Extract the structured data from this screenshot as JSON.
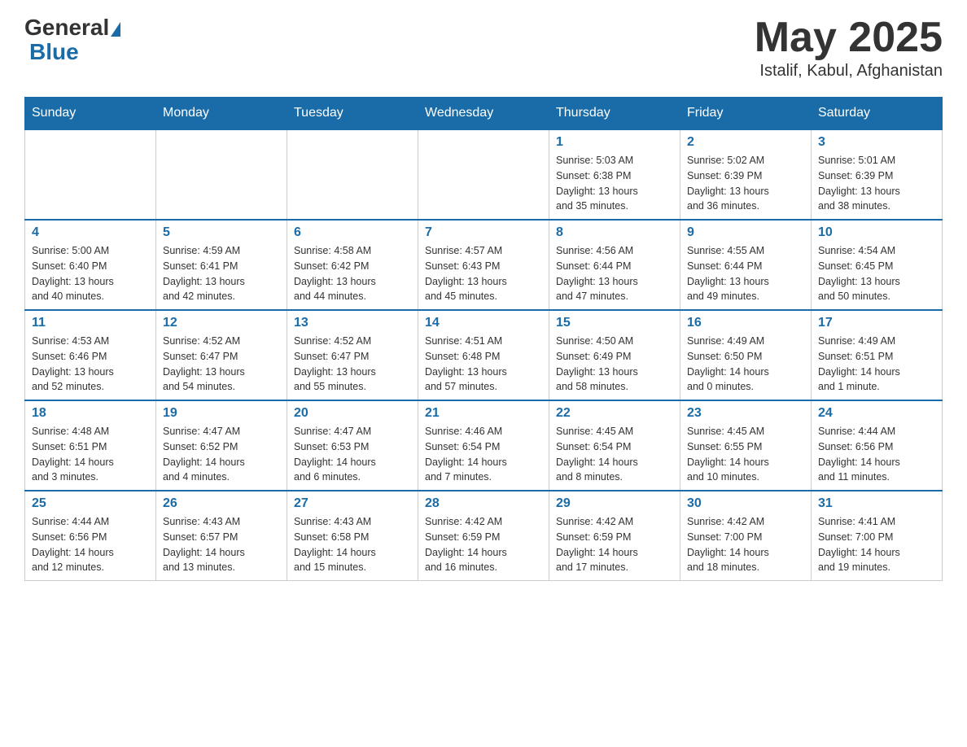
{
  "header": {
    "logo_general": "General",
    "logo_blue": "Blue",
    "month_year": "May 2025",
    "location": "Istalif, Kabul, Afghanistan"
  },
  "days_of_week": [
    "Sunday",
    "Monday",
    "Tuesday",
    "Wednesday",
    "Thursday",
    "Friday",
    "Saturday"
  ],
  "weeks": [
    [
      {
        "day": "",
        "info": ""
      },
      {
        "day": "",
        "info": ""
      },
      {
        "day": "",
        "info": ""
      },
      {
        "day": "",
        "info": ""
      },
      {
        "day": "1",
        "info": "Sunrise: 5:03 AM\nSunset: 6:38 PM\nDaylight: 13 hours\nand 35 minutes."
      },
      {
        "day": "2",
        "info": "Sunrise: 5:02 AM\nSunset: 6:39 PM\nDaylight: 13 hours\nand 36 minutes."
      },
      {
        "day": "3",
        "info": "Sunrise: 5:01 AM\nSunset: 6:39 PM\nDaylight: 13 hours\nand 38 minutes."
      }
    ],
    [
      {
        "day": "4",
        "info": "Sunrise: 5:00 AM\nSunset: 6:40 PM\nDaylight: 13 hours\nand 40 minutes."
      },
      {
        "day": "5",
        "info": "Sunrise: 4:59 AM\nSunset: 6:41 PM\nDaylight: 13 hours\nand 42 minutes."
      },
      {
        "day": "6",
        "info": "Sunrise: 4:58 AM\nSunset: 6:42 PM\nDaylight: 13 hours\nand 44 minutes."
      },
      {
        "day": "7",
        "info": "Sunrise: 4:57 AM\nSunset: 6:43 PM\nDaylight: 13 hours\nand 45 minutes."
      },
      {
        "day": "8",
        "info": "Sunrise: 4:56 AM\nSunset: 6:44 PM\nDaylight: 13 hours\nand 47 minutes."
      },
      {
        "day": "9",
        "info": "Sunrise: 4:55 AM\nSunset: 6:44 PM\nDaylight: 13 hours\nand 49 minutes."
      },
      {
        "day": "10",
        "info": "Sunrise: 4:54 AM\nSunset: 6:45 PM\nDaylight: 13 hours\nand 50 minutes."
      }
    ],
    [
      {
        "day": "11",
        "info": "Sunrise: 4:53 AM\nSunset: 6:46 PM\nDaylight: 13 hours\nand 52 minutes."
      },
      {
        "day": "12",
        "info": "Sunrise: 4:52 AM\nSunset: 6:47 PM\nDaylight: 13 hours\nand 54 minutes."
      },
      {
        "day": "13",
        "info": "Sunrise: 4:52 AM\nSunset: 6:47 PM\nDaylight: 13 hours\nand 55 minutes."
      },
      {
        "day": "14",
        "info": "Sunrise: 4:51 AM\nSunset: 6:48 PM\nDaylight: 13 hours\nand 57 minutes."
      },
      {
        "day": "15",
        "info": "Sunrise: 4:50 AM\nSunset: 6:49 PM\nDaylight: 13 hours\nand 58 minutes."
      },
      {
        "day": "16",
        "info": "Sunrise: 4:49 AM\nSunset: 6:50 PM\nDaylight: 14 hours\nand 0 minutes."
      },
      {
        "day": "17",
        "info": "Sunrise: 4:49 AM\nSunset: 6:51 PM\nDaylight: 14 hours\nand 1 minute."
      }
    ],
    [
      {
        "day": "18",
        "info": "Sunrise: 4:48 AM\nSunset: 6:51 PM\nDaylight: 14 hours\nand 3 minutes."
      },
      {
        "day": "19",
        "info": "Sunrise: 4:47 AM\nSunset: 6:52 PM\nDaylight: 14 hours\nand 4 minutes."
      },
      {
        "day": "20",
        "info": "Sunrise: 4:47 AM\nSunset: 6:53 PM\nDaylight: 14 hours\nand 6 minutes."
      },
      {
        "day": "21",
        "info": "Sunrise: 4:46 AM\nSunset: 6:54 PM\nDaylight: 14 hours\nand 7 minutes."
      },
      {
        "day": "22",
        "info": "Sunrise: 4:45 AM\nSunset: 6:54 PM\nDaylight: 14 hours\nand 8 minutes."
      },
      {
        "day": "23",
        "info": "Sunrise: 4:45 AM\nSunset: 6:55 PM\nDaylight: 14 hours\nand 10 minutes."
      },
      {
        "day": "24",
        "info": "Sunrise: 4:44 AM\nSunset: 6:56 PM\nDaylight: 14 hours\nand 11 minutes."
      }
    ],
    [
      {
        "day": "25",
        "info": "Sunrise: 4:44 AM\nSunset: 6:56 PM\nDaylight: 14 hours\nand 12 minutes."
      },
      {
        "day": "26",
        "info": "Sunrise: 4:43 AM\nSunset: 6:57 PM\nDaylight: 14 hours\nand 13 minutes."
      },
      {
        "day": "27",
        "info": "Sunrise: 4:43 AM\nSunset: 6:58 PM\nDaylight: 14 hours\nand 15 minutes."
      },
      {
        "day": "28",
        "info": "Sunrise: 4:42 AM\nSunset: 6:59 PM\nDaylight: 14 hours\nand 16 minutes."
      },
      {
        "day": "29",
        "info": "Sunrise: 4:42 AM\nSunset: 6:59 PM\nDaylight: 14 hours\nand 17 minutes."
      },
      {
        "day": "30",
        "info": "Sunrise: 4:42 AM\nSunset: 7:00 PM\nDaylight: 14 hours\nand 18 minutes."
      },
      {
        "day": "31",
        "info": "Sunrise: 4:41 AM\nSunset: 7:00 PM\nDaylight: 14 hours\nand 19 minutes."
      }
    ]
  ]
}
